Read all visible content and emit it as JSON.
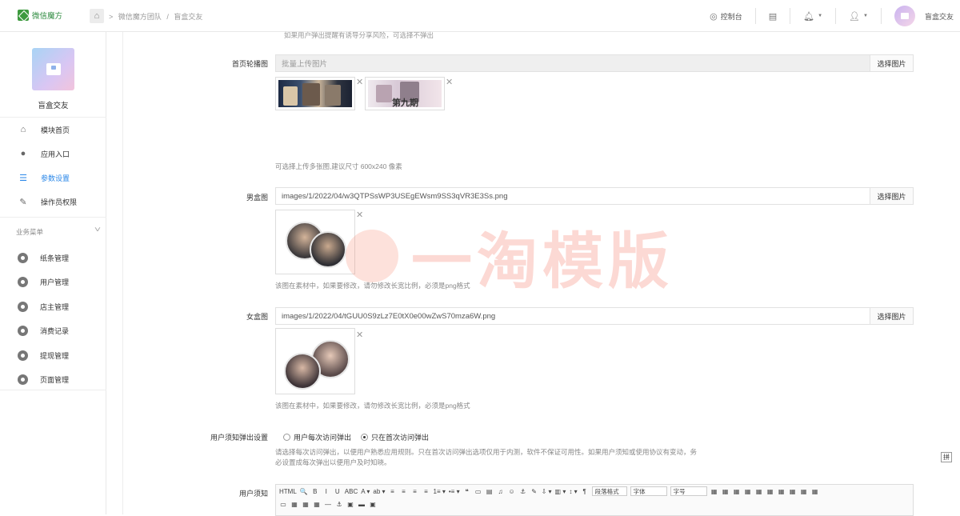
{
  "header": {
    "logo_text": "微信魔方",
    "breadcrumb": [
      "微信魔方团队",
      "/",
      "盲盒交友"
    ],
    "console_label": "控制台",
    "user_name": "盲盒交友"
  },
  "sidebar": {
    "app_name": "盲盒交友",
    "items": [
      {
        "label": "模块首页",
        "icon": "home-icon"
      },
      {
        "label": "应用入口",
        "icon": "chat-icon"
      },
      {
        "label": "参数设置",
        "icon": "list-icon",
        "active": true
      },
      {
        "label": "操作员权限",
        "icon": "edit-icon"
      }
    ],
    "group_title": "业务菜单",
    "sub_items": [
      "纸条管理",
      "用户管理",
      "店主管理",
      "消费记录",
      "提现管理",
      "页面管理"
    ]
  },
  "form": {
    "top_hint": "如果用户弹出提醒有诱导分享风险，可选择不弹出",
    "carousel": {
      "label": "首页轮播图",
      "placeholder": "批量上传图片",
      "button": "选择图片",
      "hint": "可选择上传多张图,建议尺寸 600x240 像素",
      "banner2_text": "第九期"
    },
    "male_box": {
      "label": "男盒图",
      "value": "images/1/2022/04/w3QTPSsWP3USEgEWsm9SS3qVR3E3Ss.png",
      "button": "选择图片",
      "hint": "该图在素材中，如果要修改，请勿修改长宽比例，必须是png格式"
    },
    "female_box": {
      "label": "女盒图",
      "value": "images/1/2022/04/tGUU0S9zLz7E0tX0e00wZwS70mza6W.png",
      "button": "选择图片",
      "hint": "该图在素材中，如果要修改，请勿修改长宽比例，必须是png格式"
    },
    "notice_popup": {
      "label": "用户须知弹出设置",
      "option1": "用户每次访问弹出",
      "option2": "只在首次访问弹出",
      "selected": "只在首次访问弹出",
      "hint_line1": "请选择每次访问弹出，以便用户熟悉应用规则。只在首次访问弹出选项仅用于内测，软件不保证可用性。如果用户须知或使用协议有变动，务",
      "hint_line2": "必设置成每次弹出以便用户及时知晓。"
    },
    "notice": {
      "label": "用户须知",
      "toolbar_row1": [
        "HTML",
        "🔍",
        "B",
        "I",
        "U",
        "ABC",
        "A ▾",
        "ab ▾",
        "≡",
        "≡",
        "≡",
        "≡",
        "1≡ ▾",
        "•≡ ▾",
        "❝",
        "▭",
        "▤",
        "♫",
        "☺",
        "⚓",
        "✎",
        "⇩ ▾",
        "▥ ▾",
        "↕ ▾",
        "¶"
      ],
      "paragraph_select": "段落格式",
      "font_select": "字体",
      "size_select": "字号",
      "toolbar_row1_tail": [
        "▦",
        "▦",
        "▦",
        "▦",
        "▦",
        "▦",
        "▦",
        "▦",
        "▦",
        "▦"
      ],
      "toolbar_row2": [
        "▭",
        "▦",
        "▦",
        "▦",
        "—",
        "⚓",
        "▣",
        "▬",
        "▣"
      ]
    }
  },
  "watermark": "一淘模版",
  "float_tag": "拼",
  "colors": {
    "accent": "#2a87e8",
    "logo_green": "#3d9a3f"
  }
}
